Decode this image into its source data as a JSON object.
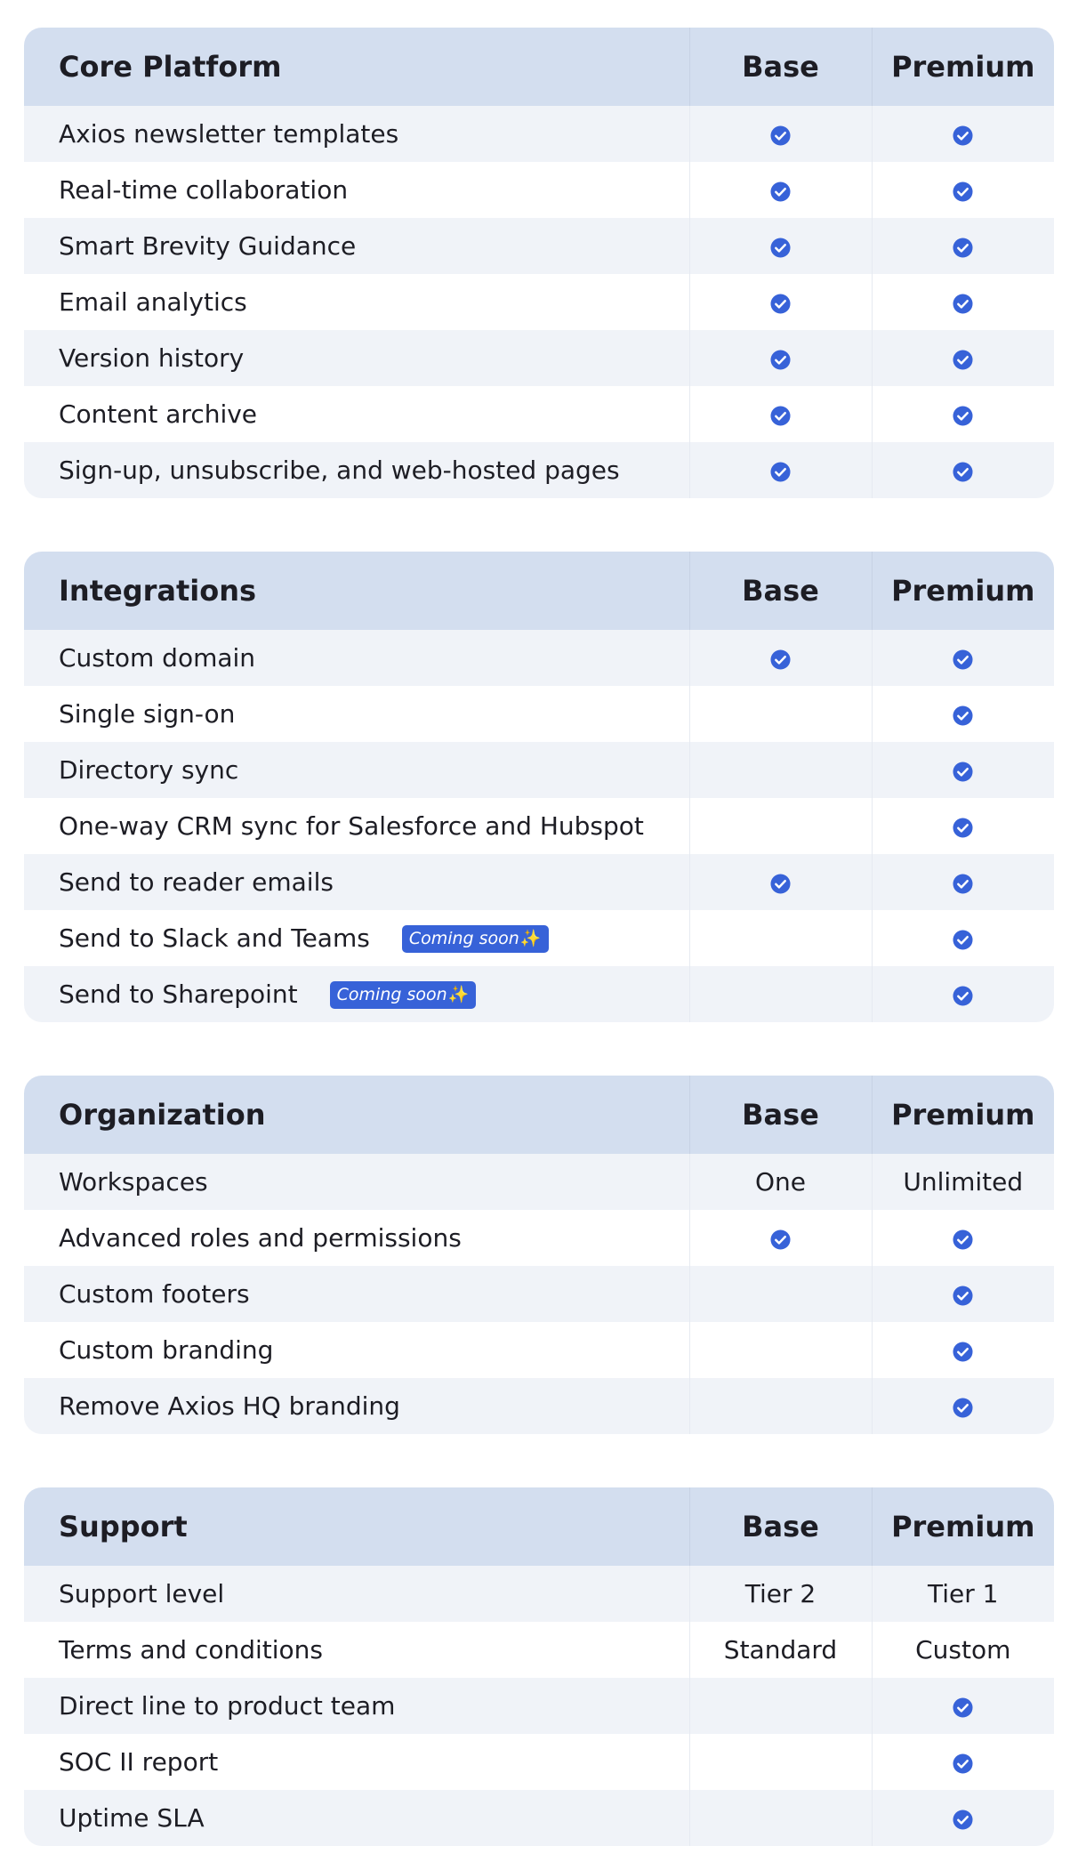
{
  "colors": {
    "header_bg": "#d3deef",
    "row_alt_bg": "#f0f3f8",
    "check_blue": "#3762d8",
    "badge_blue": "#3762d8"
  },
  "icons": {
    "check": "check-circle-icon",
    "sparkle": "sparkle-icon"
  },
  "sections": [
    {
      "title": "Core Platform",
      "col_base": "Base",
      "col_premium": "Premium",
      "rows": [
        {
          "feature": "Axios newsletter templates",
          "base": "check",
          "premium": "check"
        },
        {
          "feature": "Real-time collaboration",
          "base": "check",
          "premium": "check"
        },
        {
          "feature": "Smart Brevity Guidance",
          "base": "check",
          "premium": "check"
        },
        {
          "feature": "Email analytics",
          "base": "check",
          "premium": "check"
        },
        {
          "feature": "Version history",
          "base": "check",
          "premium": "check"
        },
        {
          "feature": "Content archive",
          "base": "check",
          "premium": "check"
        },
        {
          "feature": "Sign-up, unsubscribe, and web-hosted pages",
          "base": "check",
          "premium": "check"
        }
      ]
    },
    {
      "title": "Integrations",
      "col_base": "Base",
      "col_premium": "Premium",
      "rows": [
        {
          "feature": "Custom domain",
          "base": "check",
          "premium": "check"
        },
        {
          "feature": "Single sign-on",
          "base": "",
          "premium": "check"
        },
        {
          "feature": "Directory sync",
          "base": "",
          "premium": "check"
        },
        {
          "feature": "One-way CRM sync for Salesforce and Hubspot",
          "base": "",
          "premium": "check"
        },
        {
          "feature": "Send to reader emails",
          "base": "check",
          "premium": "check"
        },
        {
          "feature": "Send to Slack and Teams",
          "badge": "Coming soon",
          "base": "",
          "premium": "check"
        },
        {
          "feature": "Send to Sharepoint",
          "badge": "Coming soon",
          "base": "",
          "premium": "check"
        }
      ]
    },
    {
      "title": "Organization",
      "col_base": "Base",
      "col_premium": "Premium",
      "rows": [
        {
          "feature": "Workspaces",
          "base": "One",
          "premium": "Unlimited"
        },
        {
          "feature": "Advanced roles and permissions",
          "base": "check",
          "premium": "check"
        },
        {
          "feature": "Custom footers",
          "base": "",
          "premium": "check"
        },
        {
          "feature": "Custom branding",
          "base": "",
          "premium": "check"
        },
        {
          "feature": "Remove Axios HQ branding",
          "base": "",
          "premium": "check"
        }
      ]
    },
    {
      "title": "Support",
      "col_base": "Base",
      "col_premium": "Premium",
      "rows": [
        {
          "feature": "Support level",
          "base": "Tier 2",
          "premium": "Tier 1"
        },
        {
          "feature": "Terms and conditions",
          "base": "Standard",
          "premium": "Custom"
        },
        {
          "feature": "Direct line to product team",
          "base": "",
          "premium": "check"
        },
        {
          "feature": "SOC II report",
          "base": "",
          "premium": "check"
        },
        {
          "feature": "Uptime SLA",
          "base": "",
          "premium": "check"
        }
      ]
    }
  ]
}
